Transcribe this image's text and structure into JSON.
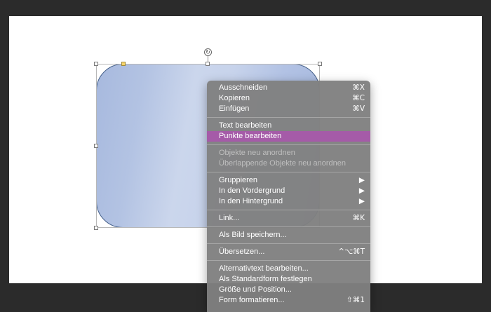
{
  "colors": {
    "background": "#2b2b2b",
    "slide": "#ffffff",
    "shape_fill": "#b3c3e3",
    "menu_bg": "#808080",
    "highlight": "#a55ba8"
  },
  "canvas": {
    "rotate_glyph": "↻"
  },
  "context_menu": {
    "items": [
      {
        "label": "Ausschneiden",
        "shortcut": "⌘X"
      },
      {
        "label": "Kopieren",
        "shortcut": "⌘C"
      },
      {
        "label": "Einfügen",
        "shortcut": "⌘V"
      },
      {
        "label": "Text bearbeiten",
        "shortcut": ""
      },
      {
        "label": "Punkte bearbeiten",
        "shortcut": ""
      },
      {
        "label": "Objekte neu anordnen",
        "shortcut": ""
      },
      {
        "label": "Überlappende Objekte neu anordnen",
        "shortcut": ""
      },
      {
        "label": "Gruppieren",
        "shortcut": "▶"
      },
      {
        "label": "In den Vordergrund",
        "shortcut": "▶"
      },
      {
        "label": "In den Hintergrund",
        "shortcut": "▶"
      },
      {
        "label": "Link...",
        "shortcut": "⌘K"
      },
      {
        "label": "Als Bild speichern...",
        "shortcut": ""
      },
      {
        "label": "Übersetzen...",
        "shortcut": "^⌥⌘T"
      },
      {
        "label": "Alternativtext bearbeiten...",
        "shortcut": ""
      },
      {
        "label": "Als Standardform festlegen",
        "shortcut": ""
      },
      {
        "label": "Größe und Position...",
        "shortcut": ""
      },
      {
        "label": "Form formatieren...",
        "shortcut": "⇧⌘1"
      }
    ]
  }
}
